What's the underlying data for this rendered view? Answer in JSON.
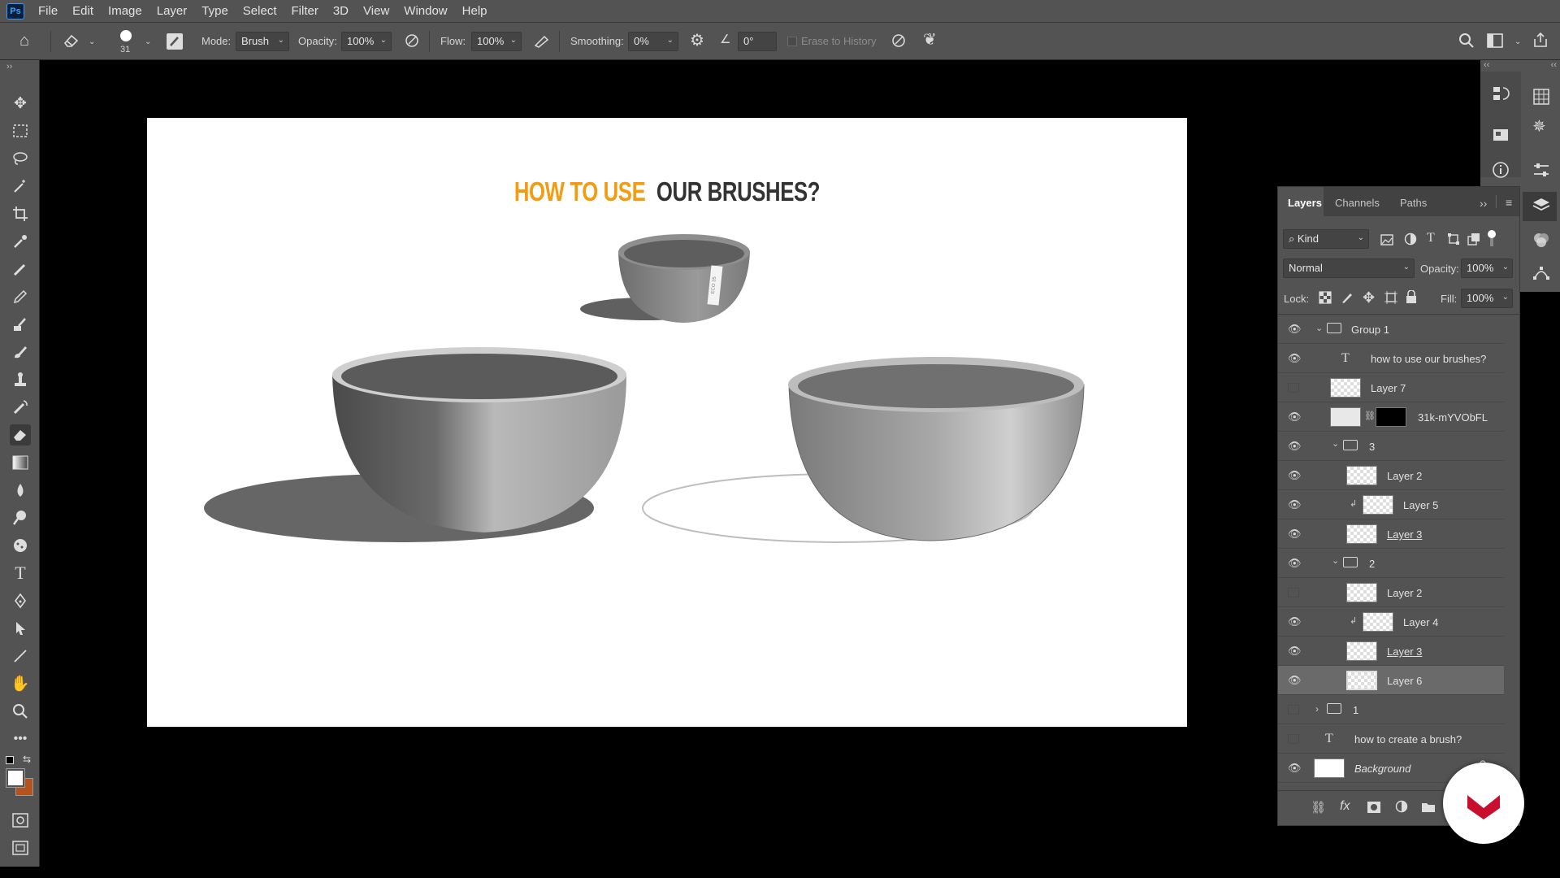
{
  "menubar": {
    "logo": "Ps",
    "items": [
      "File",
      "Edit",
      "Image",
      "Layer",
      "Type",
      "Select",
      "Filter",
      "3D",
      "View",
      "Window",
      "Help"
    ]
  },
  "options": {
    "brush_size": "31",
    "mode_label": "Mode:",
    "mode_value": "Brush",
    "opacity_label": "Opacity:",
    "opacity_value": "100%",
    "flow_label": "Flow:",
    "flow_value": "100%",
    "smoothing_label": "Smoothing:",
    "smoothing_value": "0%",
    "angle_value": "0°",
    "erase_history_label": "Erase to History"
  },
  "canvas": {
    "headline_part1": "HOW TO USE",
    "headline_part2": "OUR BRUSHES?",
    "tag_text": "ECO 35"
  },
  "layers_panel": {
    "tabs": [
      "Layers",
      "Channels",
      "Paths"
    ],
    "filter_kind": "Kind",
    "blend_mode": "Normal",
    "opacity_label": "Opacity:",
    "opacity_value": "100%",
    "lock_label": "Lock:",
    "fill_label": "Fill:",
    "fill_value": "100%",
    "layers": [
      {
        "name": "Group 1",
        "type": "group",
        "visible": true,
        "indent": 0,
        "open": true
      },
      {
        "name": "how to use  our brushes?",
        "type": "text",
        "visible": true,
        "indent": 1
      },
      {
        "name": "Layer 7",
        "type": "pixel",
        "visible": false,
        "indent": 1
      },
      {
        "name": "31k-mYVObFL",
        "type": "smart-masked",
        "visible": true,
        "indent": 1
      },
      {
        "name": "3",
        "type": "group",
        "visible": true,
        "indent": 1,
        "open": true
      },
      {
        "name": "Layer 2",
        "type": "pixel",
        "visible": true,
        "indent": 2
      },
      {
        "name": "Layer 5",
        "type": "pixel-clipped",
        "visible": true,
        "indent": 2
      },
      {
        "name": "Layer 3",
        "type": "pixel",
        "visible": true,
        "indent": 2
      },
      {
        "name": "2",
        "type": "group",
        "visible": true,
        "indent": 1,
        "open": true
      },
      {
        "name": "Layer 2",
        "type": "pixel",
        "visible": false,
        "indent": 2
      },
      {
        "name": "Layer 4",
        "type": "pixel-clipped",
        "visible": true,
        "indent": 2
      },
      {
        "name": "Layer 3",
        "type": "pixel",
        "visible": true,
        "indent": 2
      },
      {
        "name": "Layer 6",
        "type": "pixel",
        "visible": true,
        "indent": 2,
        "selected": true
      },
      {
        "name": "1",
        "type": "group",
        "visible": false,
        "indent": 0,
        "open": false
      },
      {
        "name": "how to create a brush?",
        "type": "text",
        "visible": false,
        "indent": 0
      },
      {
        "name": "Background",
        "type": "background",
        "visible": true,
        "indent": 0
      }
    ]
  },
  "colors": {
    "accent_orange": "#f39c12",
    "foreground": "#ffffff",
    "background": "#b5531e",
    "badge_red": "#c8102e"
  }
}
